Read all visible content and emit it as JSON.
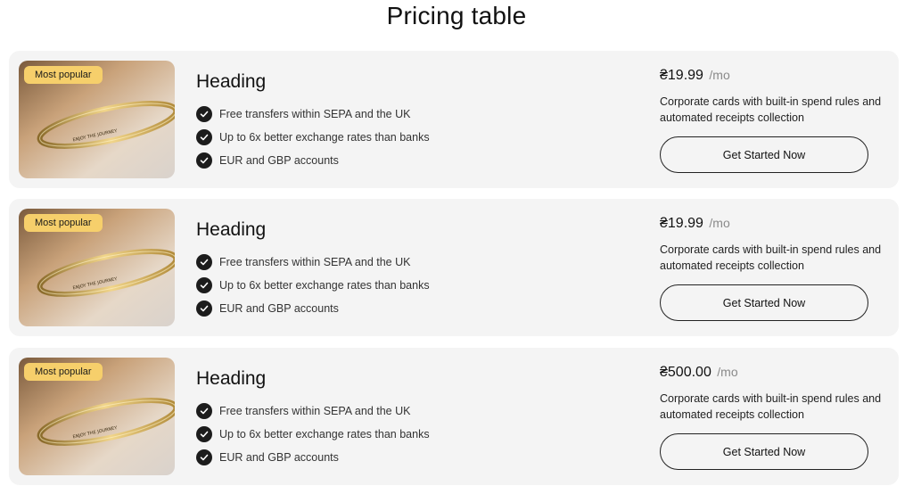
{
  "page": {
    "title": "Pricing table"
  },
  "colors": {
    "card_bg": "#f4f4f4",
    "badge_bg": "#f6cf6b",
    "check_bg": "#1c1c1c",
    "muted": "#8a8a8a"
  },
  "cards": [
    {
      "badge": "Most popular",
      "image_icon": "gold-bracelet-photo",
      "bracelet_text": "ENJOY THE JOURNEY",
      "heading": "Heading",
      "features": [
        "Free transfers within SEPA and the UK",
        "Up to 6x better exchange rates than banks",
        "EUR and GBP accounts"
      ],
      "price": "₴19.99",
      "period": "/mo",
      "description": "Corporate cards with built-in spend rules and automated receipts collection",
      "cta": "Get Started Now"
    },
    {
      "badge": "Most popular",
      "image_icon": "gold-bracelet-photo",
      "bracelet_text": "ENJOY THE JOURNEY",
      "heading": "Heading",
      "features": [
        "Free transfers within SEPA and the UK",
        "Up to 6x better exchange rates than banks",
        "EUR and GBP accounts"
      ],
      "price": "₴19.99",
      "period": "/mo",
      "description": "Corporate cards with built-in spend rules and automated receipts collection",
      "cta": "Get Started Now"
    },
    {
      "badge": "Most popular",
      "image_icon": "gold-bracelet-photo",
      "bracelet_text": "ENJOY THE JOURNEY",
      "heading": "Heading",
      "features": [
        "Free transfers within SEPA and the UK",
        "Up to 6x better exchange rates than banks",
        "EUR and GBP accounts"
      ],
      "price": "₴500.00",
      "period": "/mo",
      "description": "Corporate cards with built-in spend rules and automated receipts collection",
      "cta": "Get Started Now"
    }
  ]
}
